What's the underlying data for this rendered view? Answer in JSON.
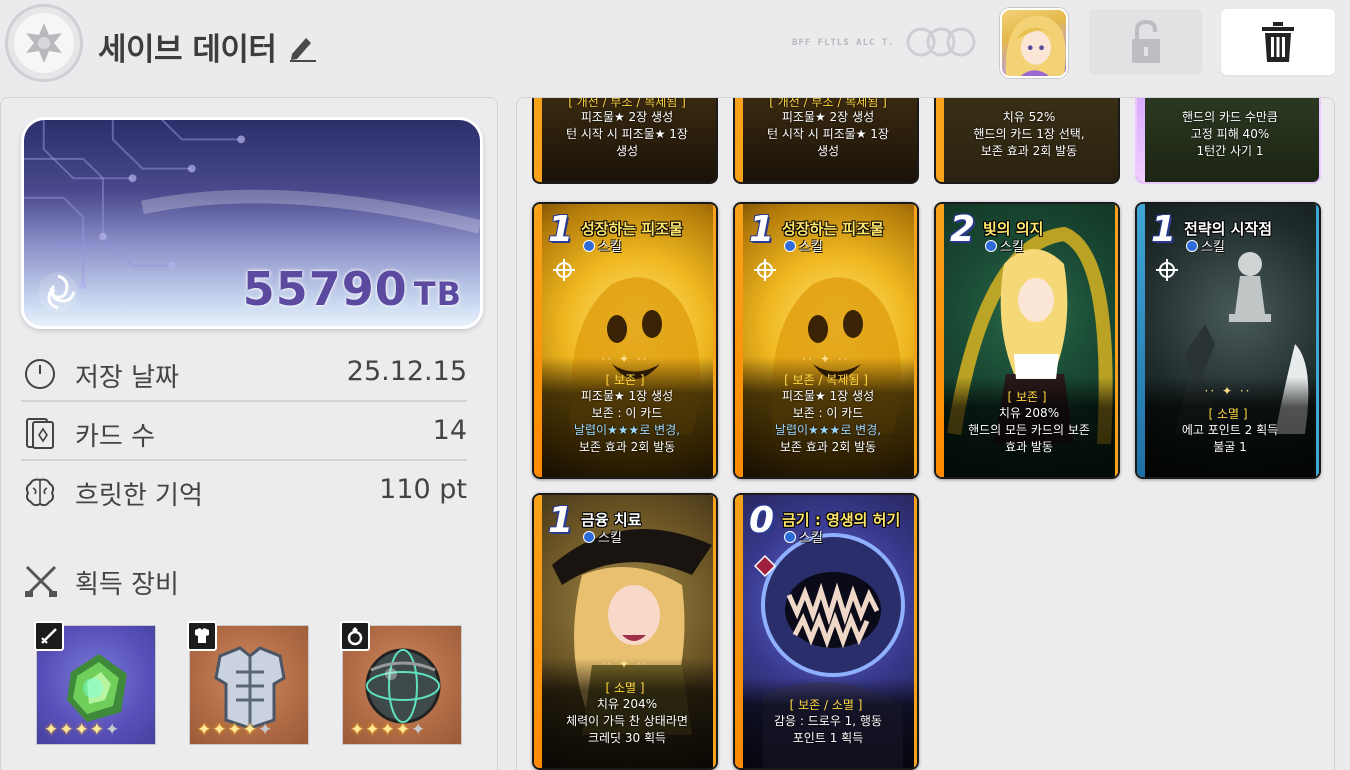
{
  "header": {
    "title": "세이브 데이터",
    "brand_text": "BFF FLTLS ALC T.",
    "avatar_alt": "character portrait"
  },
  "colors": {
    "accent_purple": "#5b4aa0",
    "card_frame": "#f7a21a",
    "panel_bg": "#ececee"
  },
  "tb": {
    "value": "55790",
    "unit": "TB"
  },
  "stats": [
    {
      "label": "저장 날짜",
      "value": "25.12.15",
      "icon": "clock-icon"
    },
    {
      "label": "카드 수",
      "value": "14",
      "icon": "cards-icon"
    },
    {
      "label": "흐릿한 기억",
      "value": "110 pt",
      "icon": "brain-icon"
    }
  ],
  "equipment": {
    "label": "획득 장비",
    "items": [
      {
        "slot": "weapon",
        "icon": "sword-icon",
        "stars": 4,
        "max": 5
      },
      {
        "slot": "armor",
        "icon": "armor-icon",
        "stars": 4,
        "max": 5
      },
      {
        "slot": "accessory",
        "icon": "ring-icon",
        "stars": 4,
        "max": 5
      }
    ]
  },
  "top_cards": [
    {
      "tag": "[ 개전 / 부조 / 복제됨 ]",
      "lines": [
        "피조물★ 2장 생성",
        "턴 시작 시 피조물★ 1장",
        "생성"
      ]
    },
    {
      "tag": "[ 개전 / 부조 / 복제됨 ]",
      "lines": [
        "피조물★ 2장 생성",
        "턴 시작 시 피조물★ 1장",
        "생성"
      ]
    },
    {
      "tag": "",
      "lines": [
        "치유 52%",
        "핸드의 카드 1장 선택,",
        "보존 효과 2회 발동"
      ]
    },
    {
      "tag": "",
      "lines": [
        "핸드의 카드 수만큼",
        "고정 피해 40%",
        "1턴간 사기 1"
      ]
    }
  ],
  "cards": [
    {
      "cost": "1",
      "name": "성장하는 피조물",
      "type": "스킬",
      "tag": "[ 보존 ]",
      "lines": [
        "피조물★ 1장 생성",
        "보존 : 이 카드",
        "날렵이★★★로 변경,",
        "보존 효과 2회 발동"
      ],
      "theme": "gold"
    },
    {
      "cost": "1",
      "name": "성장하는 피조물",
      "type": "스킬",
      "tag": "[ 보존 / 복제됨 ]",
      "lines": [
        "피조물★ 1장 생성",
        "보존 : 이 카드",
        "날렵이★★★로 변경,",
        "보존 효과 2회 발동"
      ],
      "theme": "gold"
    },
    {
      "cost": "2",
      "name": "빛의 의지",
      "type": "스킬",
      "tag": "[ 보존 ]",
      "lines": [
        "치유 208%",
        "핸드의 모든 카드의 보존",
        "효과 발동"
      ],
      "theme": "green"
    },
    {
      "cost": "1",
      "name": "전략의 시작점",
      "type": "스킬",
      "tag": "[ 소멸 ]",
      "lines": [
        "에고 포인트 2 획득",
        "불굴 1"
      ],
      "theme": "dark"
    },
    {
      "cost": "1",
      "name": "금융 치료",
      "type": "스킬",
      "tag": "[ 소멸 ]",
      "lines": [
        "치유 204%",
        "체력이 가득 찬 상태라면",
        "크레딧 30 획득"
      ],
      "theme": "olive"
    },
    {
      "cost": "0",
      "name": "금기 : 영생의 허기",
      "type": "스킬",
      "tag": "[ 보존 / 소멸 ]",
      "lines": [
        "감응 : 드로우 1, 행동",
        "포인트 1 획득"
      ],
      "theme": "blue"
    }
  ]
}
